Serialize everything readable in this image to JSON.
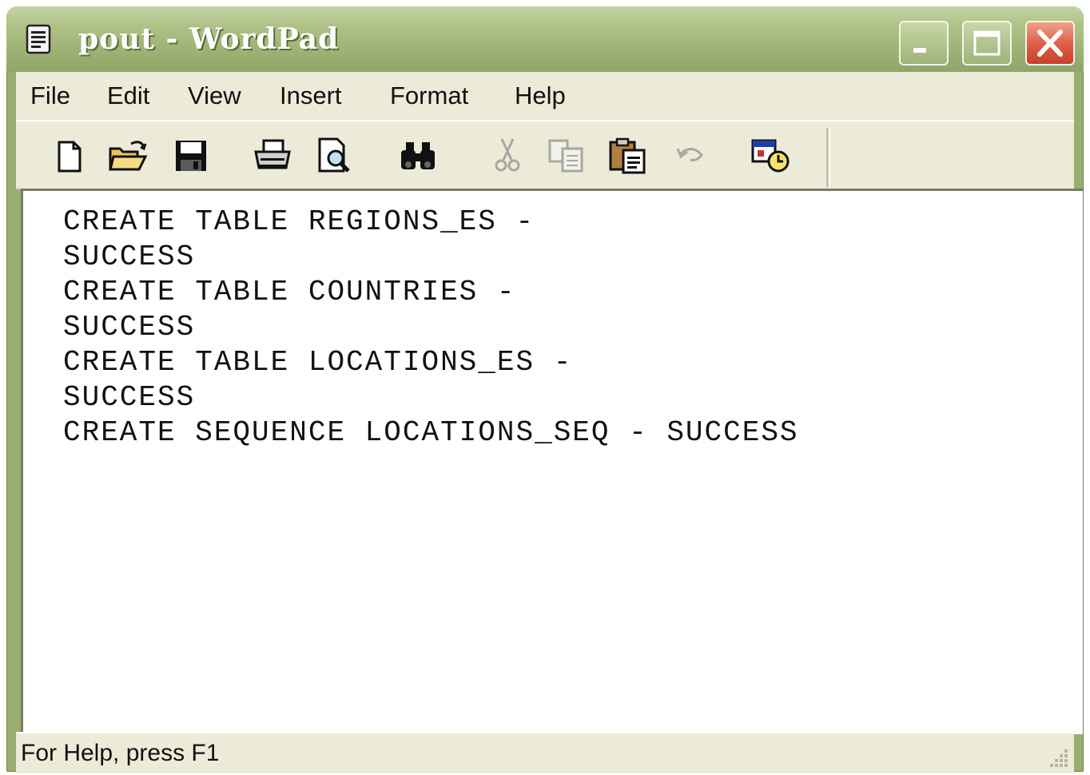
{
  "window": {
    "title": "pout - WordPad"
  },
  "menu": {
    "items": [
      "File",
      "Edit",
      "View",
      "Insert",
      "Format",
      "Help"
    ]
  },
  "toolbar": {
    "tools": [
      {
        "icon": "new-document-icon",
        "enabled": true
      },
      {
        "icon": "open-folder-icon",
        "enabled": true
      },
      {
        "icon": "save-disk-icon",
        "enabled": true
      },
      {
        "icon": "print-icon",
        "enabled": true
      },
      {
        "icon": "print-preview-icon",
        "enabled": true
      },
      {
        "icon": "find-binoculars-icon",
        "enabled": true
      },
      {
        "icon": "cut-scissors-icon",
        "enabled": false
      },
      {
        "icon": "copy-icon",
        "enabled": false
      },
      {
        "icon": "paste-icon",
        "enabled": true
      },
      {
        "icon": "undo-icon",
        "enabled": false
      },
      {
        "icon": "date-time-icon",
        "enabled": true
      }
    ]
  },
  "document": {
    "lines": [
      "CREATE TABLE REGIONS_ES -",
      "SUCCESS",
      "CREATE TABLE COUNTRIES -",
      "SUCCESS",
      "CREATE TABLE LOCATIONS_ES -",
      "SUCCESS",
      "CREATE SEQUENCE LOCATIONS_SEQ - SUCCESS"
    ]
  },
  "status": {
    "text": "For Help, press F1"
  },
  "colors": {
    "titlebar": "#9cb174",
    "chrome": "#ecebd8",
    "close_button": "#e0604a"
  }
}
